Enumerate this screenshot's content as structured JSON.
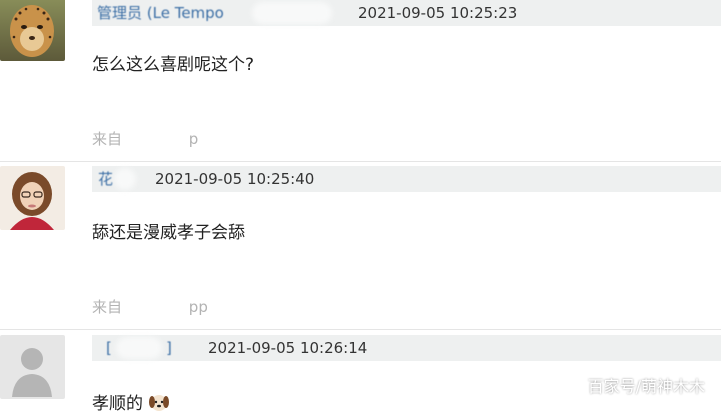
{
  "posts": [
    {
      "username": "管理员 (Le Tempo",
      "timestamp": "2021-09-05 10:25:23",
      "content": "怎么这么喜剧呢这个?",
      "source": "来自",
      "source_suffix": "p",
      "avatar_icon": "cheetah-avatar-icon"
    },
    {
      "username": "花",
      "timestamp": "2021-09-05 10:25:40",
      "content": "舔还是漫威孝子会舔",
      "source": "来自",
      "source_suffix": "pp",
      "avatar_icon": "girl-avatar-icon"
    },
    {
      "username": "[",
      "username_suffix": "]",
      "timestamp": "2021-09-05 10:26:14",
      "content": "孝顺的",
      "avatar_icon": "default-avatar-icon",
      "emoji_icon": "dog-face-icon"
    }
  ],
  "watermark": "百家号/萌神木木"
}
